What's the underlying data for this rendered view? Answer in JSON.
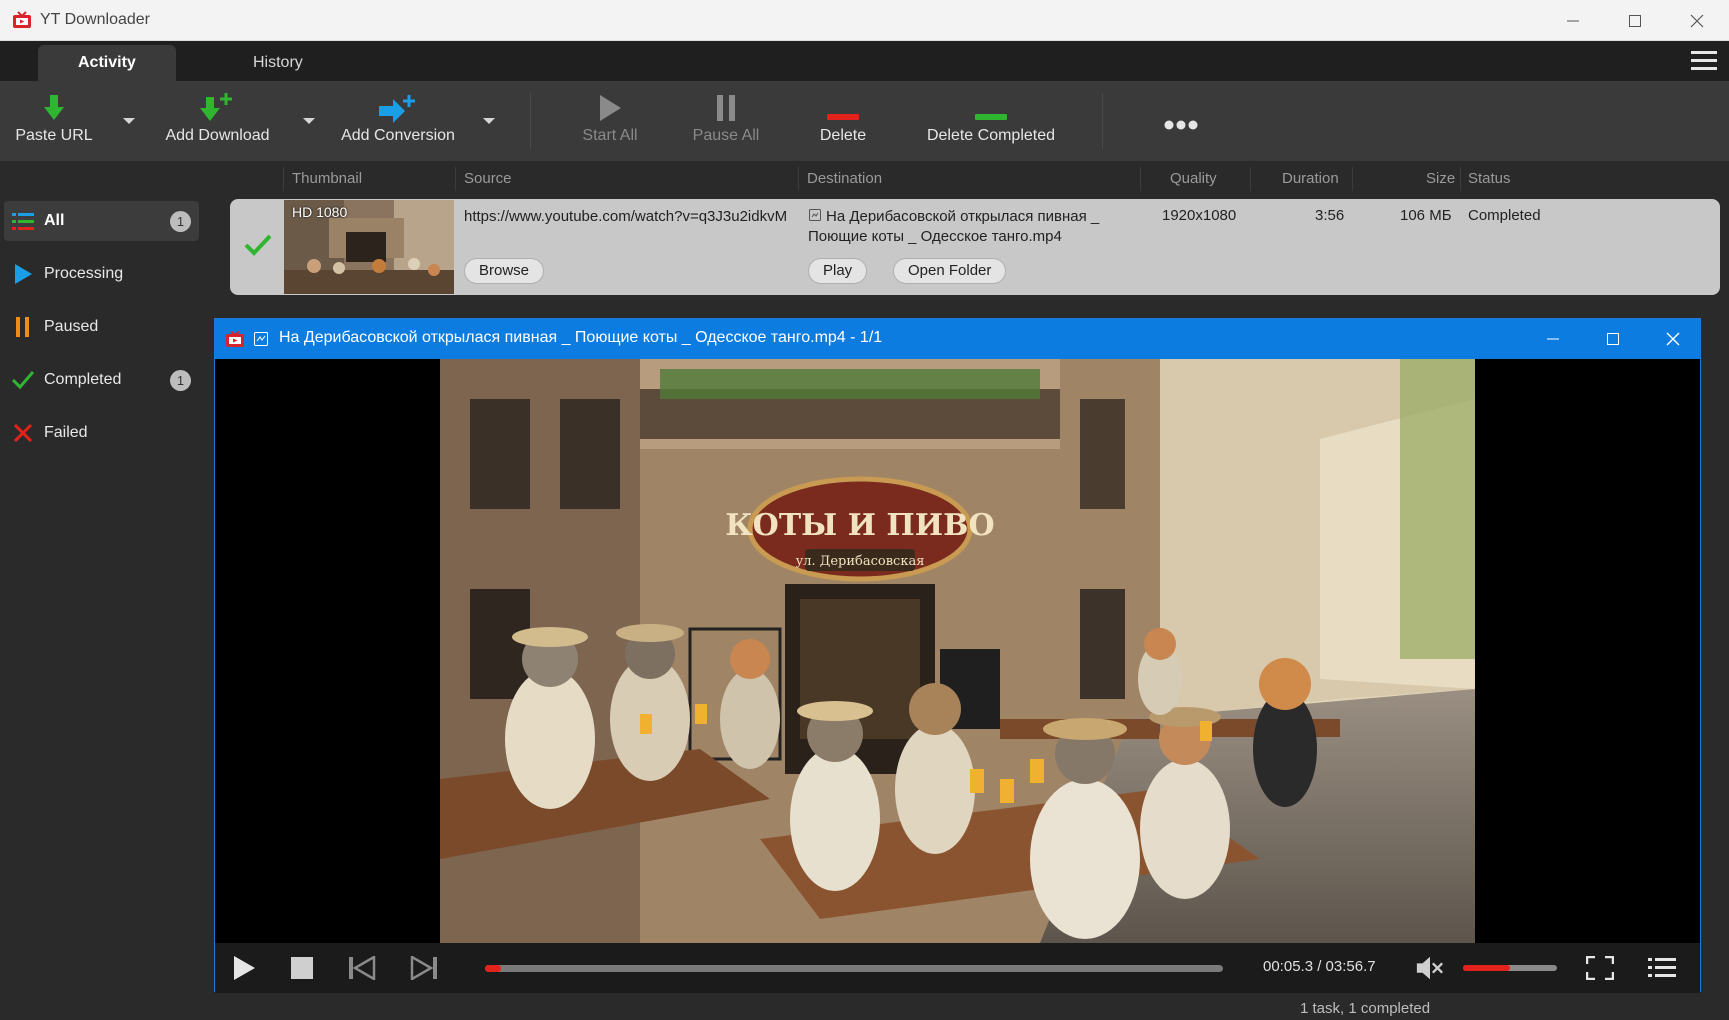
{
  "window": {
    "title": "YT Downloader"
  },
  "tabs": [
    {
      "label": "Activity",
      "active": true
    },
    {
      "label": "History",
      "active": false
    }
  ],
  "toolbar": {
    "paste_url": "Paste URL",
    "add_download": "Add Download",
    "add_conversion": "Add Conversion",
    "start_all": "Start All",
    "pause_all": "Pause All",
    "delete": "Delete",
    "delete_completed": "Delete Completed"
  },
  "columns": {
    "thumbnail": "Thumbnail",
    "source": "Source",
    "destination": "Destination",
    "quality": "Quality",
    "duration": "Duration",
    "size": "Size",
    "status": "Status"
  },
  "sidebar": {
    "items": [
      {
        "label": "All",
        "count": "1",
        "icon": "list-icon",
        "active": true
      },
      {
        "label": "Processing",
        "count": "",
        "icon": "play-icon"
      },
      {
        "label": "Paused",
        "count": "",
        "icon": "pause-icon"
      },
      {
        "label": "Completed",
        "count": "1",
        "icon": "check-icon"
      },
      {
        "label": "Failed",
        "count": "",
        "icon": "x-icon"
      }
    ]
  },
  "download": {
    "thumb_badge": "HD 1080",
    "source": "https://www.youtube.com/watch?v=q3J3u2idkvM",
    "browse": "Browse",
    "destination": "На Дерибасовской открылася пивная _ Поющие коты _ Одесское танго.mp4",
    "play": "Play",
    "open_folder": "Open Folder",
    "quality": "1920x1080",
    "duration": "3:56",
    "size": "106 МБ",
    "status": "Completed"
  },
  "player": {
    "title": "На Дерибасовской открылася пивная _ Поющие коты _ Одесское танго.mp4 - 1/1",
    "time": "00:05.3 / 03:56.7",
    "progress": 0.022,
    "volume": 0.5,
    "video_sign": "КОТЫ И ПИВО",
    "video_subsign": "ул. Дерибасовская"
  },
  "status_bar": {
    "text": "1 task, 1 completed"
  },
  "colors": {
    "accent": "#0c7ce0",
    "green": "#2fb52f",
    "red": "#e3231b",
    "blue": "#1a9ee8"
  }
}
